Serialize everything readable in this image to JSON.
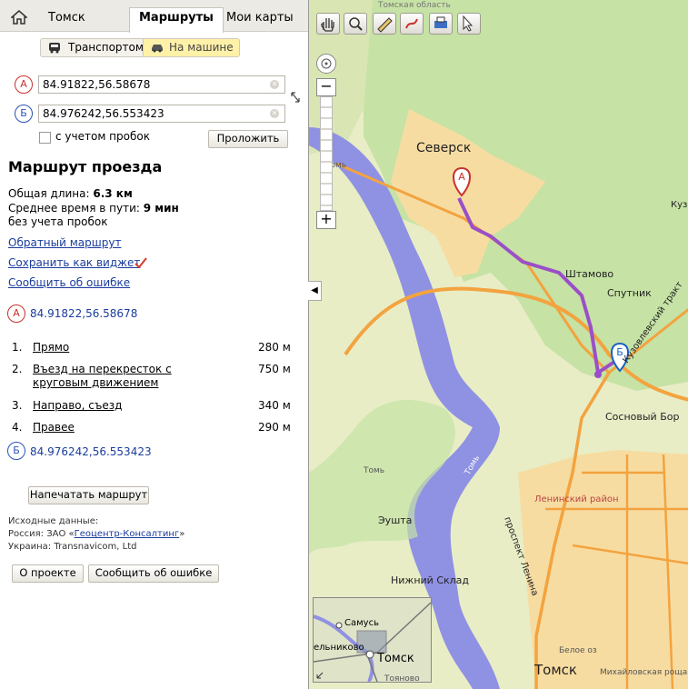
{
  "tabs": {
    "tomsk": "Томск",
    "routes": "Маршруты",
    "my_maps": "Мои карты"
  },
  "mode": {
    "transport": "Транспортом",
    "car": "На машине"
  },
  "inputs": {
    "a_letter": "А",
    "b_letter": "Б",
    "a_value": "84.91822,56.58678",
    "b_value": "84.976242,56.553423"
  },
  "traffic": {
    "label": "с учетом пробок",
    "button": "Проложить"
  },
  "route": {
    "title": "Маршрут проезда",
    "length_label": "Общая длина: ",
    "length_value": "6.3 км",
    "time_label": "Среднее время в пути: ",
    "time_value": "9 мин",
    "no_traffic": "без учета пробок",
    "reverse": "Обратный маршрут",
    "save_widget": "Сохранить как виджет",
    "report_error": "Сообщить об ошибке",
    "start": "84.91822,56.58678",
    "end": "84.976242,56.553423",
    "steps": [
      {
        "num": "1.",
        "text": "Прямо",
        "dist": "280 м"
      },
      {
        "num": "2.",
        "text": "Въезд на перекресток с круговым движением",
        "dist": "750 м"
      },
      {
        "num": "3.",
        "text": "Направо, съезд",
        "dist": "340 м"
      },
      {
        "num": "4.",
        "text": "Правее",
        "dist": "290 м"
      }
    ],
    "print": "Напечатать маршрут"
  },
  "source": {
    "title": "Исходные данные:",
    "russia_prefix": "Россия: ЗАО «",
    "russia_link": "Геоцентр-Консалтинг",
    "russia_suffix": "»",
    "ukraine": "Украина: Transnavicom, Ltd"
  },
  "footer": {
    "about": "О проекте",
    "report": "Сообщить об ошибке"
  },
  "map_labels": {
    "seversk": "Северск",
    "shtamovo": "Штамово",
    "sputnik": "Спутник",
    "sosnovy_bor": "Сосновый Бор",
    "leninsky": "Ленинский район",
    "eushta": "Эушта",
    "nizhny_sklad": "Нижний Склад",
    "tomsk": "Томск",
    "tom_river": "Томь",
    "prospekt_lenina": "проспект Ленина",
    "kuzovlevsky": "Кузовлевский тракт",
    "tomsk_oblast": "Томская область",
    "mikhailovskaya": "Михайловская роща",
    "beloe_oz": "Белое оз",
    "kuzo": "Кузо",
    "tom_upper": "Томь",
    "tom_mid": "Томь"
  },
  "minimap": {
    "samus": "Самусь",
    "melnikovo": "ельниково",
    "tomsk": "Томск",
    "toyanovo": "Тояново"
  },
  "colors": {
    "route": "#9a4fc8",
    "river": "#8f91e3",
    "urban": "#f7dca1",
    "forest": "#c6e2a5",
    "road": "#f3a33f"
  }
}
